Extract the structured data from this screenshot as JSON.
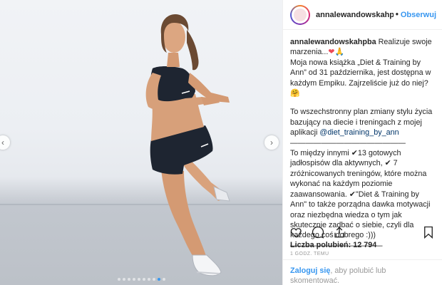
{
  "header": {
    "username": "annalewandowskahpba",
    "separator": "•",
    "follow_label": "Obserwuj",
    "avatar_icon": "profile-avatar-icon"
  },
  "caption": {
    "username": "annalewandowskahpba",
    "line1_text": "Realizuje swoje marzenia...",
    "line1_emoji": "❤",
    "line1_emoji2": "🙏",
    "p1": "Moja nowa książka „Diet & Training by Ann” od 31 października, jest dostępna w każdym Empiku. Zajrzeliście już do niej?",
    "p1_emoji": "🤗",
    "p2_text": "To wszechstronny plan zmiany stylu życia bazujący na diecie i treningach z mojej aplikacji ",
    "p2_mention": "@diet_training_by_ann",
    "divider1": "———————————————",
    "p3": "To między innymi ✔13 gotowych jadłospisów dla aktywnych, ✔ 7 zróżnicowanych treningów, które można wykonać na każdym poziomie zaawansowania. ✔\"Diet & Training by Ann\" to także porządna dawka motywacji oraz niezbędna wiedza o tym jak skutecznie zadbać o siebie, czyli dla każdego coś dobrego :)))",
    "divider2": "————————————"
  },
  "actions": {
    "like_icon": "heart-icon",
    "comment_icon": "comment-icon",
    "share_icon": "share-icon",
    "save_icon": "bookmark-icon"
  },
  "likes": {
    "label": "Liczba polubień:",
    "count": "12 794"
  },
  "timestamp": "1 GODZ. TEMU",
  "login": {
    "link": "Zaloguj się",
    "text": ", aby polubić lub skomentować."
  },
  "carousel": {
    "total": 10,
    "active_index": 8,
    "prev_icon": "chevron-left-icon",
    "next_icon": "chevron-right-icon"
  }
}
